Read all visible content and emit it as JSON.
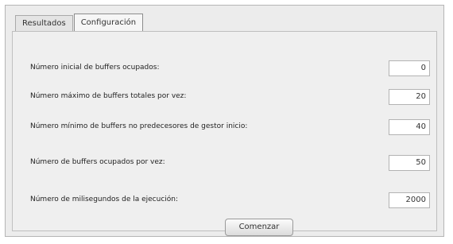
{
  "tabs": [
    {
      "label": "Resultados",
      "active": false
    },
    {
      "label": "Configuración",
      "active": true
    }
  ],
  "settings": [
    {
      "label": "Número inicial de buffers ocupados:",
      "value": "0"
    },
    {
      "label": "Número máximo de buffers totales por vez:",
      "value": "20"
    },
    {
      "label": "Número mínimo de buffers no predecesores de gestor inicio:",
      "value": "40"
    },
    {
      "label": "Número de buffers ocupados por vez:",
      "value": "50"
    },
    {
      "label": "Número de milisegundos de la ejecución:",
      "value": "2000"
    }
  ],
  "actions": {
    "start_label": "Comenzar"
  }
}
